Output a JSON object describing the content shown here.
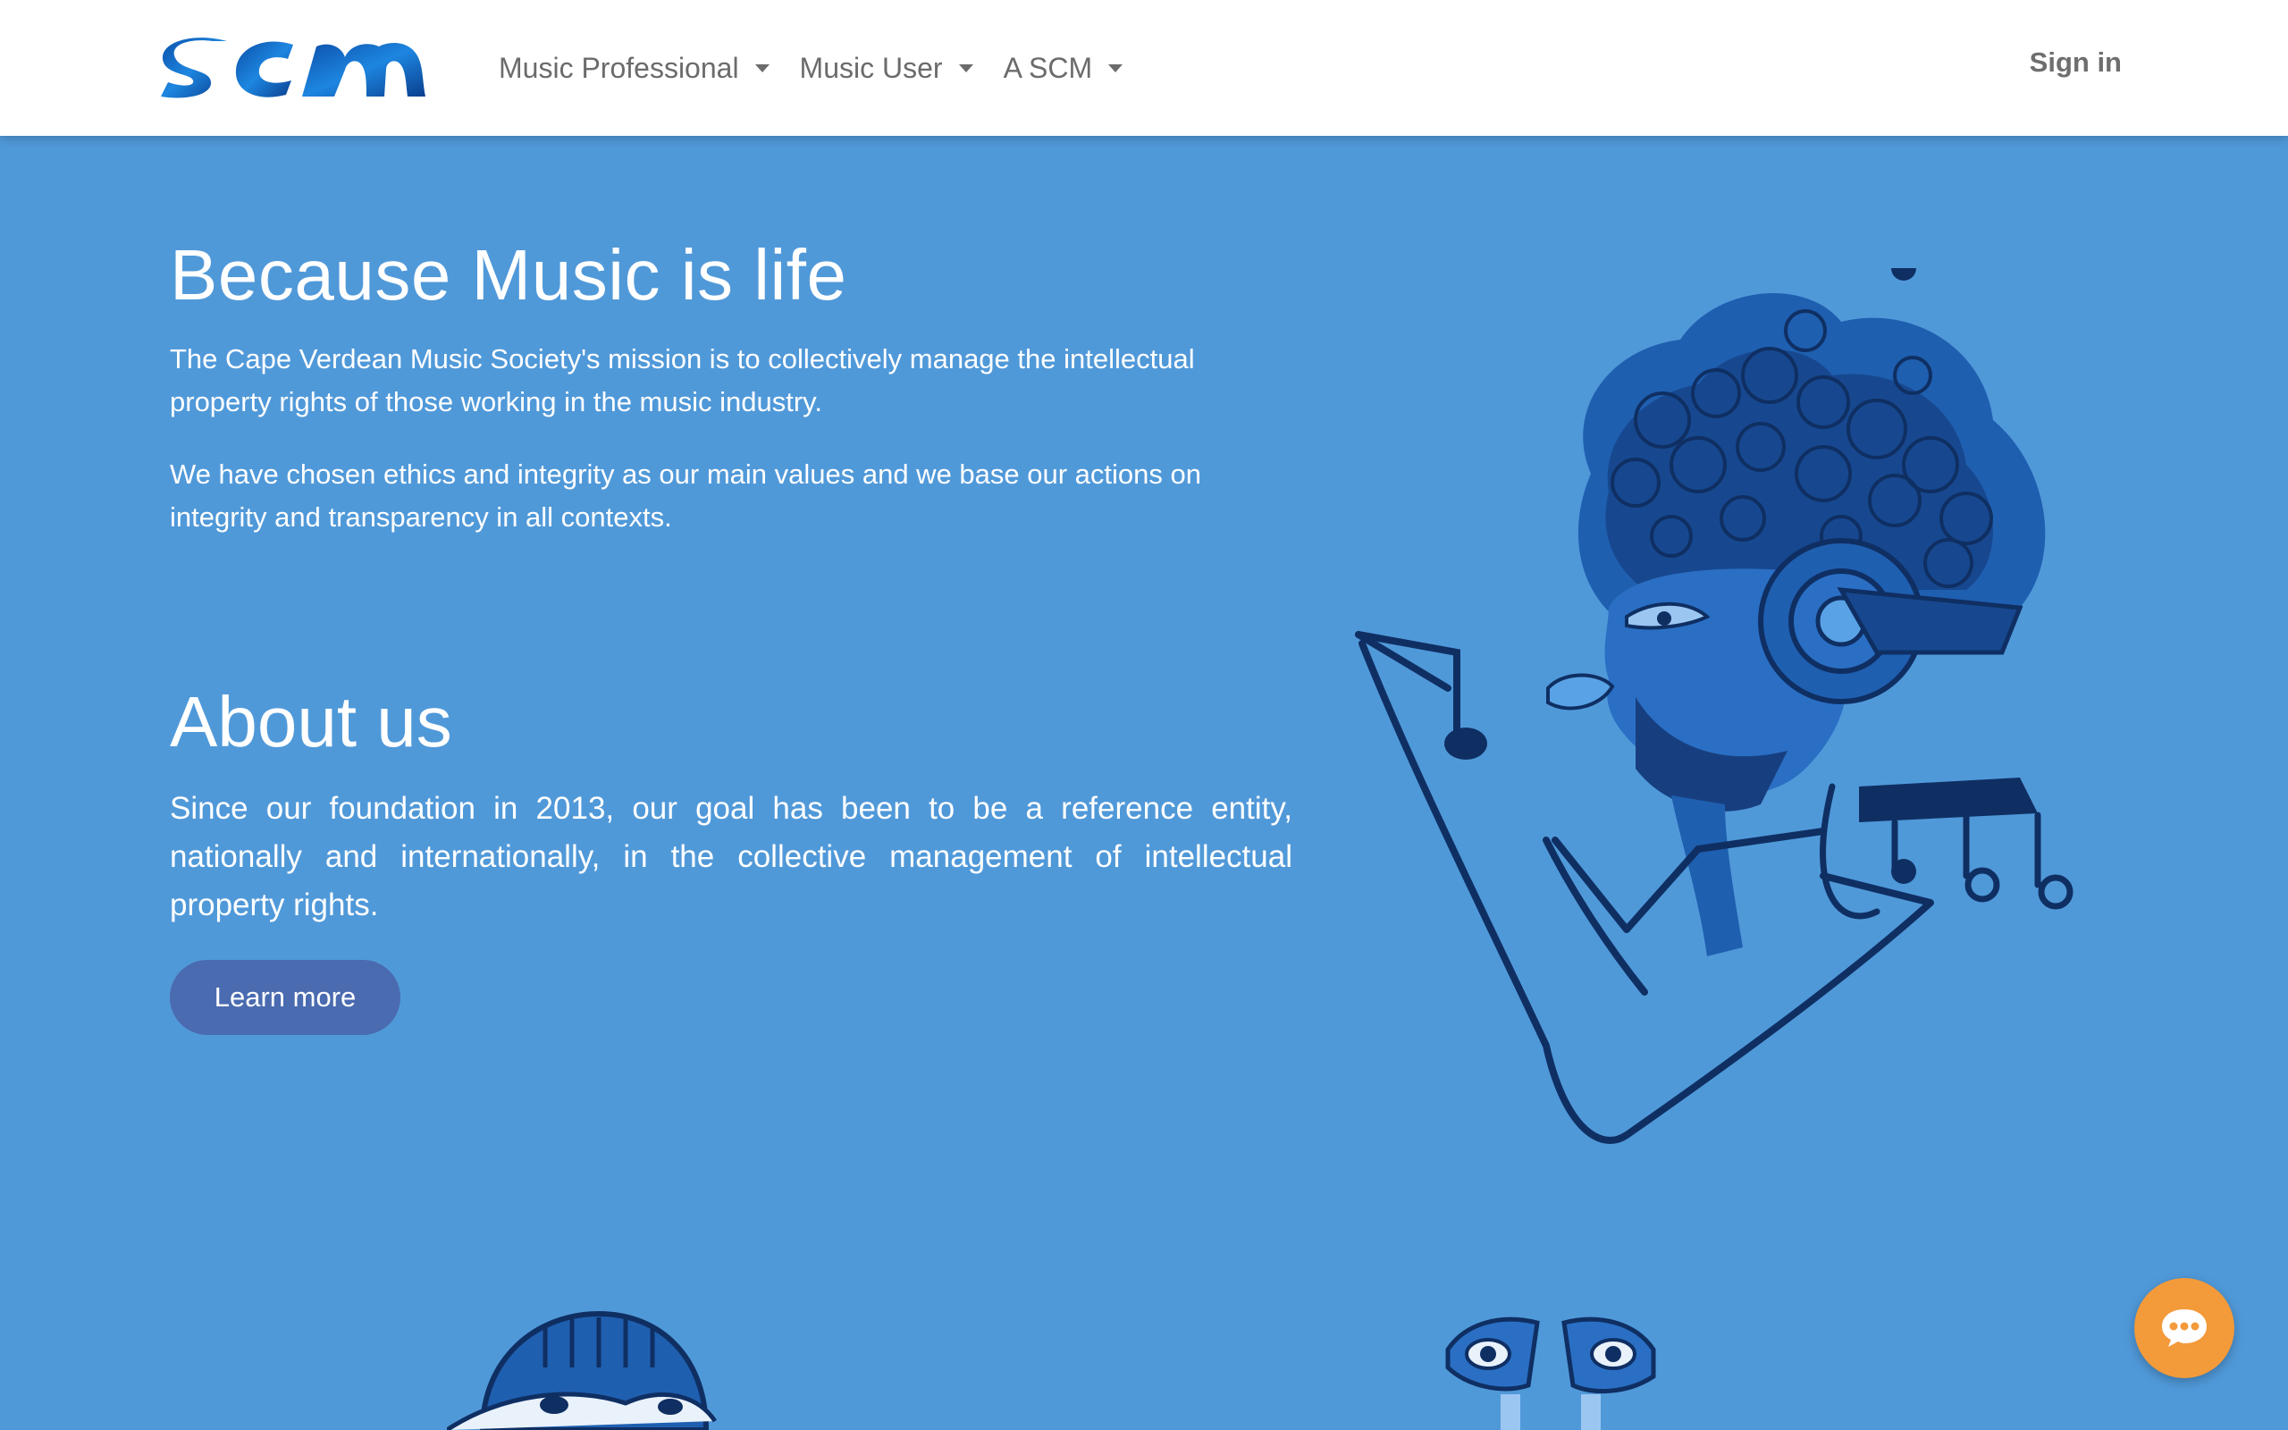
{
  "brand": {
    "logo_text": "SCM"
  },
  "nav": {
    "items": [
      {
        "label": "Music Professional"
      },
      {
        "label": "Music User"
      },
      {
        "label": "A SCM"
      }
    ],
    "signin_label": "Sign in"
  },
  "hero": {
    "title": "Because Music is life",
    "paragraph1": "The Cape Verdean Music Society's mission is to collectively manage the intellectual property rights of those working in the music industry.",
    "paragraph2": "We have chosen ethics and integrity as our main values and we base our actions on integrity and transparency in all contexts."
  },
  "about": {
    "title": "About us",
    "paragraph": "Since our foundation in 2013, our goal has been to be a reference entity, nationally and internationally, in the collective management of intellectual property rights.",
    "button_label": "Learn more"
  },
  "chat": {
    "icon": "chat-bubble-icon"
  },
  "colors": {
    "background": "#5099d9",
    "navbar": "#ffffff",
    "button": "#4a6bb0",
    "chat": "#f39a3a",
    "illustration_dark": "#0f2f63",
    "illustration_mid": "#1f5fb0"
  }
}
